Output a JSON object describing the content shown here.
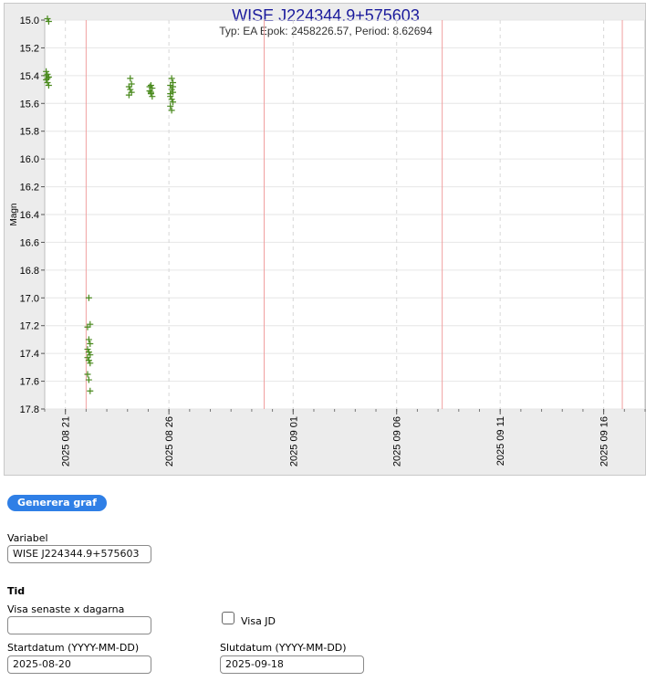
{
  "chart_data": {
    "type": "scatter",
    "title": "WISE J224344.9+575603",
    "subtitle": "Typ: EA Epok: 2458226.57, Period: 8.62694",
    "ylabel": "Magn",
    "xlabel": "",
    "y_inverted": true,
    "ylim": [
      15.0,
      17.8
    ],
    "xlim": [
      "2025-08-20",
      "2025-09-18"
    ],
    "y_ticks": [
      "15.0",
      "15.2",
      "15.4",
      "15.6",
      "15.8",
      "16.0",
      "16.2",
      "16.4",
      "16.6",
      "16.8",
      "17.0",
      "17.2",
      "17.4",
      "17.6",
      "17.8"
    ],
    "x_tick_labels": [
      "2025 08 21",
      "2025 08 26",
      "2025 09 01",
      "2025 09 06",
      "2025 09 11",
      "2025 09 16"
    ],
    "x_tick_dates": [
      "2025-08-21",
      "2025-08-26",
      "2025-09-01",
      "2025-09-06",
      "2025-09-11",
      "2025-09-16"
    ],
    "minima_dates": [
      "2025-08-22",
      "2025-08-30.6",
      "2025-09-08.2",
      "2025-09-16.9"
    ],
    "grid": true,
    "marker": "plus",
    "marker_color": "#4a8a1e",
    "minima_line_color": "#f0a0a0",
    "series": [
      {
        "x": [
          "2025-08-20",
          "2025-08-20",
          "2025-08-20",
          "2025-08-20",
          "2025-08-20",
          "2025-08-20",
          "2025-08-20",
          "2025-08-20",
          "2025-08-20",
          "2025-08-20",
          "2025-08-22",
          "2025-08-22",
          "2025-08-22",
          "2025-08-22",
          "2025-08-22",
          "2025-08-22",
          "2025-08-22",
          "2025-08-22",
          "2025-08-22",
          "2025-08-22",
          "2025-08-22",
          "2025-08-22",
          "2025-08-22",
          "2025-08-22",
          "2025-08-24",
          "2025-08-24",
          "2025-08-24",
          "2025-08-24",
          "2025-08-24",
          "2025-08-24",
          "2025-08-25",
          "2025-08-25",
          "2025-08-25",
          "2025-08-25",
          "2025-08-25",
          "2025-08-25",
          "2025-08-25",
          "2025-08-26",
          "2025-08-26",
          "2025-08-26",
          "2025-08-26",
          "2025-08-26",
          "2025-08-26",
          "2025-08-26",
          "2025-08-26",
          "2025-08-26",
          "2025-08-26",
          "2025-08-26",
          "2025-08-26"
        ],
        "y": [
          14.99,
          15.01,
          15.37,
          15.39,
          15.41,
          15.43,
          15.45,
          15.47,
          15.4,
          15.42,
          17.0,
          17.19,
          17.21,
          17.3,
          17.33,
          17.37,
          17.39,
          17.41,
          17.43,
          17.45,
          17.47,
          17.55,
          17.59,
          17.67,
          15.42,
          15.46,
          15.48,
          15.5,
          15.52,
          15.54,
          15.47,
          15.49,
          15.51,
          15.53,
          15.55,
          15.48,
          15.52,
          15.42,
          15.45,
          15.47,
          15.5,
          15.52,
          15.55,
          15.57,
          15.59,
          15.62,
          15.65,
          15.48,
          15.53
        ]
      }
    ]
  },
  "form": {
    "button_label": "Generera graf",
    "variable_label": "Variabel",
    "variable_value": "WISE J224344.9+575603",
    "section_title": "Tid",
    "last_days_label": "Visa senaste x dagarna",
    "last_days_value": "",
    "show_jd_label": "Visa JD",
    "start_label": "Startdatum (YYYY-MM-DD)",
    "start_value": "2025-08-20",
    "end_label": "Slutdatum (YYYY-MM-DD)",
    "end_value": "2025-09-18"
  }
}
